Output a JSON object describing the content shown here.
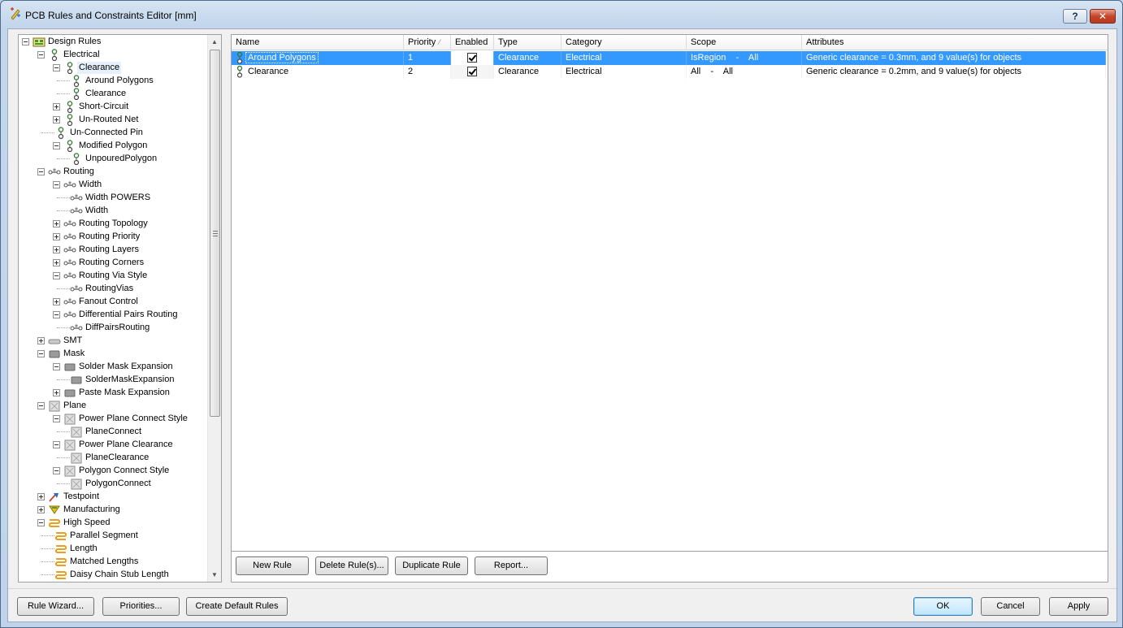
{
  "window": {
    "title": "PCB Rules and Constraints Editor [mm]",
    "help_label": "?",
    "close_label": "✕"
  },
  "tree": {
    "rows": [
      {
        "label": "Design Rules",
        "level": 0,
        "exp": "minus",
        "icon": "design-rules"
      },
      {
        "label": "Electrical",
        "level": 1,
        "exp": "minus",
        "icon": "electrical"
      },
      {
        "label": "Clearance",
        "level": 2,
        "exp": "minus",
        "icon": "electrical",
        "selected": true
      },
      {
        "label": "Around Polygons",
        "level": 3,
        "exp": "none",
        "icon": "electrical"
      },
      {
        "label": "Clearance",
        "level": 3,
        "exp": "none",
        "icon": "electrical"
      },
      {
        "label": "Short-Circuit",
        "level": 2,
        "exp": "plus",
        "icon": "electrical"
      },
      {
        "label": "Un-Routed Net",
        "level": 2,
        "exp": "plus",
        "icon": "electrical"
      },
      {
        "label": "Un-Connected Pin",
        "level": 2,
        "exp": "none",
        "icon": "electrical"
      },
      {
        "label": "Modified Polygon",
        "level": 2,
        "exp": "minus",
        "icon": "electrical"
      },
      {
        "label": "UnpouredPolygon",
        "level": 3,
        "exp": "none",
        "icon": "electrical"
      },
      {
        "label": "Routing",
        "level": 1,
        "exp": "minus",
        "icon": "routing"
      },
      {
        "label": "Width",
        "level": 2,
        "exp": "minus",
        "icon": "routing"
      },
      {
        "label": "Width POWERS",
        "level": 3,
        "exp": "none",
        "icon": "routing"
      },
      {
        "label": "Width",
        "level": 3,
        "exp": "none",
        "icon": "routing"
      },
      {
        "label": "Routing Topology",
        "level": 2,
        "exp": "plus",
        "icon": "routing"
      },
      {
        "label": "Routing Priority",
        "level": 2,
        "exp": "plus",
        "icon": "routing"
      },
      {
        "label": "Routing Layers",
        "level": 2,
        "exp": "plus",
        "icon": "routing"
      },
      {
        "label": "Routing Corners",
        "level": 2,
        "exp": "plus",
        "icon": "routing"
      },
      {
        "label": "Routing Via Style",
        "level": 2,
        "exp": "minus",
        "icon": "routing"
      },
      {
        "label": "RoutingVias",
        "level": 3,
        "exp": "none",
        "icon": "routing"
      },
      {
        "label": "Fanout Control",
        "level": 2,
        "exp": "plus",
        "icon": "routing"
      },
      {
        "label": "Differential Pairs Routing",
        "level": 2,
        "exp": "minus",
        "icon": "routing"
      },
      {
        "label": "DiffPairsRouting",
        "level": 3,
        "exp": "none",
        "icon": "routing"
      },
      {
        "label": "SMT",
        "level": 1,
        "exp": "plus",
        "icon": "smt"
      },
      {
        "label": "Mask",
        "level": 1,
        "exp": "minus",
        "icon": "mask"
      },
      {
        "label": "Solder Mask Expansion",
        "level": 2,
        "exp": "minus",
        "icon": "mask"
      },
      {
        "label": "SolderMaskExpansion",
        "level": 3,
        "exp": "none",
        "icon": "mask"
      },
      {
        "label": "Paste Mask Expansion",
        "level": 2,
        "exp": "plus",
        "icon": "mask"
      },
      {
        "label": "Plane",
        "level": 1,
        "exp": "minus",
        "icon": "plane"
      },
      {
        "label": "Power Plane Connect Style",
        "level": 2,
        "exp": "minus",
        "icon": "plane"
      },
      {
        "label": "PlaneConnect",
        "level": 3,
        "exp": "none",
        "icon": "plane"
      },
      {
        "label": "Power Plane Clearance",
        "level": 2,
        "exp": "minus",
        "icon": "plane"
      },
      {
        "label": "PlaneClearance",
        "level": 3,
        "exp": "none",
        "icon": "plane"
      },
      {
        "label": "Polygon Connect Style",
        "level": 2,
        "exp": "minus",
        "icon": "plane"
      },
      {
        "label": "PolygonConnect",
        "level": 3,
        "exp": "none",
        "icon": "plane"
      },
      {
        "label": "Testpoint",
        "level": 1,
        "exp": "plus",
        "icon": "testpoint"
      },
      {
        "label": "Manufacturing",
        "level": 1,
        "exp": "plus",
        "icon": "manufacturing"
      },
      {
        "label": "High Speed",
        "level": 1,
        "exp": "minus",
        "icon": "highspeed"
      },
      {
        "label": "Parallel Segment",
        "level": 2,
        "exp": "none",
        "icon": "highspeed"
      },
      {
        "label": "Length",
        "level": 2,
        "exp": "none",
        "icon": "highspeed"
      },
      {
        "label": "Matched Lengths",
        "level": 2,
        "exp": "none",
        "icon": "highspeed"
      },
      {
        "label": "Daisy Chain Stub Length",
        "level": 2,
        "exp": "none",
        "icon": "highspeed"
      }
    ]
  },
  "grid": {
    "columns": [
      "Name",
      "Priority",
      "Enabled",
      "Type",
      "Category",
      "Scope",
      "Attributes"
    ],
    "sort_indicator": "⁄",
    "rows": [
      {
        "name": "Around Polygons",
        "priority": "1",
        "enabled": true,
        "type": "Clearance",
        "category": "Electrical",
        "scope": "IsRegion    -    All",
        "attributes": "Generic clearance = 0.3mm, and 9 value(s) for objects",
        "selected": true
      },
      {
        "name": "Clearance",
        "priority": "2",
        "enabled": true,
        "type": "Clearance",
        "category": "Electrical",
        "scope": "All    -    All",
        "attributes": "Generic clearance = 0.2mm, and 9 value(s) for objects",
        "selected": false
      }
    ]
  },
  "rule_buttons": {
    "new_rule": "New Rule",
    "delete_rule": "Delete Rule(s)...",
    "duplicate_rule": "Duplicate Rule",
    "report": "Report..."
  },
  "footer_buttons": {
    "rule_wizard": "Rule Wizard...",
    "priorities": "Priorities...",
    "create_default": "Create Default Rules",
    "ok": "OK",
    "cancel": "Cancel",
    "apply": "Apply"
  },
  "colors": {
    "selection": "#3399ff",
    "window_frame": "#c3d6ec"
  }
}
